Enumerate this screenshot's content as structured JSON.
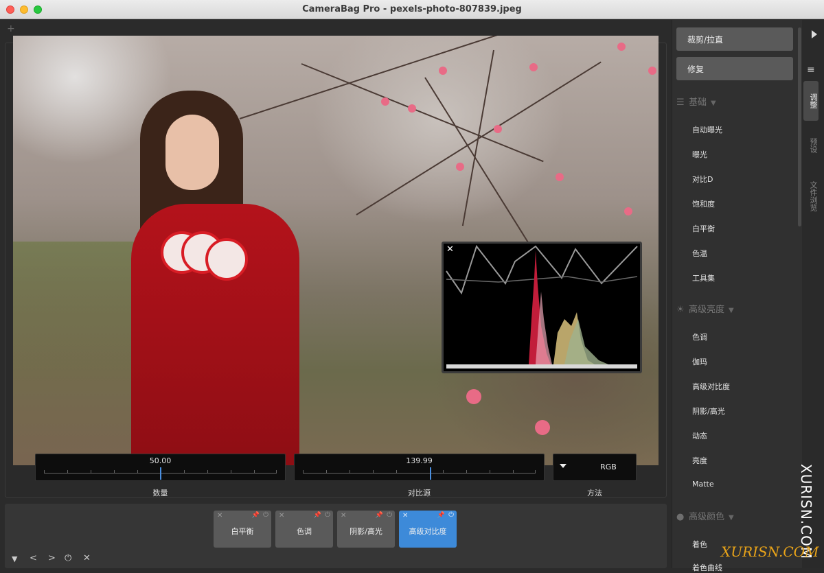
{
  "window": {
    "title": "CameraBag Pro - pexels-photo-807839.jpeg"
  },
  "editor": {
    "add_tab_glyph": "+",
    "histogram": {
      "close_glyph": "✕"
    },
    "controls": {
      "amount": {
        "value": "50.00",
        "label": "数量"
      },
      "contrast_source": {
        "value": "139.99",
        "label": "对比源"
      },
      "method": {
        "value": "RGB",
        "label": "方法"
      }
    }
  },
  "adjustment_tiles": [
    {
      "label": "白平衡",
      "active": false
    },
    {
      "label": "色调",
      "active": false
    },
    {
      "label": "阴影/高光",
      "active": false
    },
    {
      "label": "高级对比度",
      "active": true
    }
  ],
  "tile_glyphs": {
    "close": "✕",
    "pin": "📌",
    "power": "⏻"
  },
  "bottom_tools": {
    "menu": "▼",
    "prev": "<",
    "next": ">",
    "power": "⏻",
    "close": "✕"
  },
  "sidebar": {
    "crop_button": "裁剪/拉直",
    "repair_button": "修复",
    "sections": [
      {
        "title": "基础",
        "icon": "sliders-icon",
        "items": [
          "自动曝光",
          "曝光",
          "对比D",
          "饱和度",
          "白平衡",
          "色温",
          "工具集"
        ]
      },
      {
        "title": "高级亮度",
        "icon": "sun-icon",
        "items": [
          "色调",
          "伽玛",
          "高级对比度",
          "阴影/高光",
          "动态",
          "亮度",
          "Matte"
        ]
      },
      {
        "title": "高级颜色",
        "icon": "palette-icon",
        "items": [
          "着色",
          "着色曲线"
        ]
      }
    ]
  },
  "rail": {
    "tabs": [
      "调整",
      "预设",
      "文件浏览"
    ],
    "menu_glyph": "≡"
  },
  "watermark": {
    "vertical": "XURISN.COM",
    "corner": "XURISN.COM"
  },
  "colors": {
    "accent": "#3d8ad9",
    "slider_thumb": "#4a8fe0"
  }
}
